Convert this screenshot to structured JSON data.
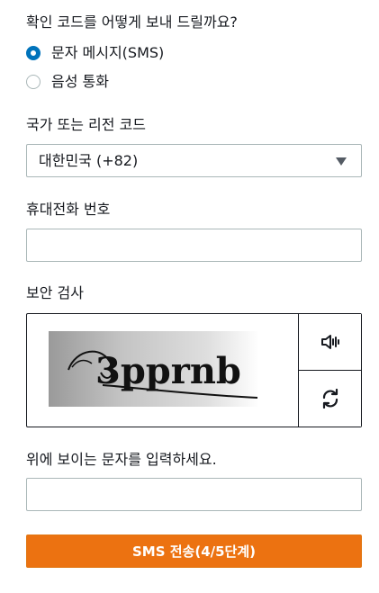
{
  "question": "확인 코드를 어떻게 보내 드릴까요?",
  "delivery_options": [
    {
      "label": "문자 메시지(SMS)",
      "selected": true
    },
    {
      "label": "음성 통화",
      "selected": false
    }
  ],
  "country": {
    "label": "국가 또는 리전 코드",
    "selected_value": "대한민국 (+82)"
  },
  "phone": {
    "label": "휴대전화 번호",
    "value": ""
  },
  "security_check": {
    "label": "보안 검사",
    "captcha_text": "3pprnb",
    "audio_icon": "speaker-icon",
    "refresh_icon": "refresh-icon"
  },
  "captcha_answer": {
    "label": "위에 보이는 문자를 입력하세요.",
    "value": ""
  },
  "submit_label": "SMS 전송(4/5단계)",
  "colors": {
    "accent": "#0073bb",
    "primary_button": "#ec7211",
    "border": "#aab7b8",
    "text": "#16191f"
  }
}
